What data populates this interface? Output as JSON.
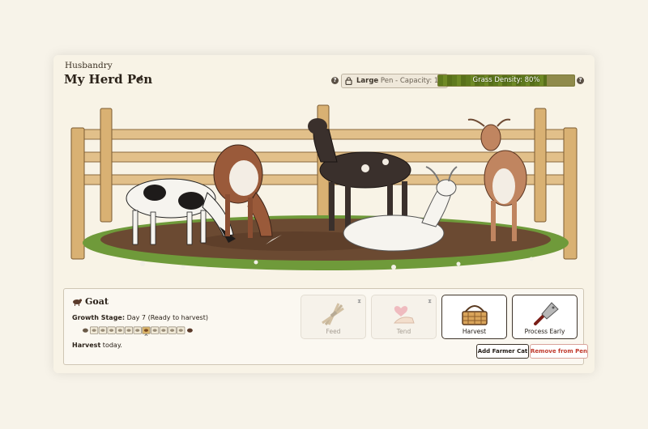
{
  "header": {
    "kicker": "Husbandry",
    "title": "My Herd Pen",
    "pen_size": "Large",
    "pen_capacity": "Pen - Capacity: 10",
    "grass_label": "Grass Density: 80%",
    "grass_density": 0.8
  },
  "animal": {
    "name": "Goat",
    "growth_label": "Growth Stage:",
    "growth_value": "Day 7 (Ready to harvest)",
    "current_day": 7,
    "total_days": 11,
    "harvest_bold": "Harvest",
    "harvest_rest": " today."
  },
  "actions": {
    "feed": "Feed",
    "tend": "Tend",
    "harvest": "Harvest",
    "process_early": "Process Early",
    "add_farmer_cat": "Add Farmer Cat",
    "remove_from_pen": "Remove from Pen"
  },
  "icons": [
    "pencil-icon",
    "help-icon",
    "lock-icon",
    "goat-icon",
    "hourglass-icon",
    "wheat-bundle-icon",
    "heart-hand-icon",
    "basket-icon",
    "cleaver-icon"
  ],
  "colors": {
    "accent_dark": "#3f352b",
    "danger": "#c0392b",
    "grass": "#5f7a1e"
  }
}
